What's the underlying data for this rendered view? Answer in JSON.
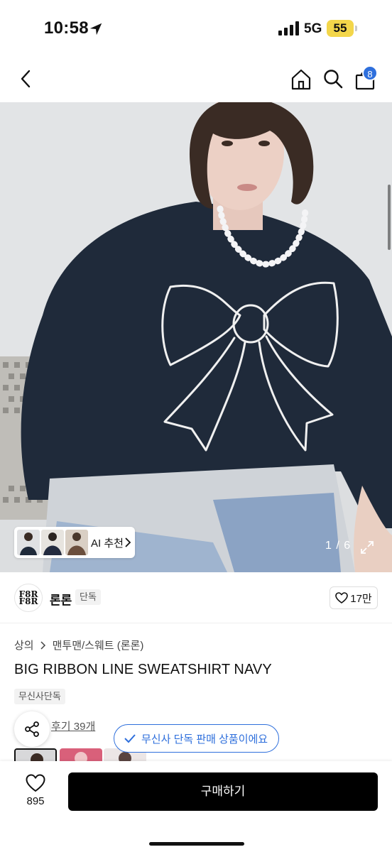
{
  "status_bar": {
    "time": "10:58",
    "network": "5G",
    "battery": "55"
  },
  "nav": {
    "cart_count": "8"
  },
  "gallery": {
    "ai_label": "AI 추천",
    "pager": "1 / 6"
  },
  "brand": {
    "logo_text_1": "F8R",
    "logo_text_2": "F8R",
    "name": "론론",
    "tag": "단독",
    "likes": "17만"
  },
  "product": {
    "breadcrumb": [
      "상의",
      "맨투맨/스웨트 (론론)"
    ],
    "title": "BIG RIBBON LINE SWEATSHIRT NAVY",
    "exclusive_tag": "무신사단독",
    "review_link": "후기 39개",
    "toast": "무신사 단독 판매 상품이에요"
  },
  "bottom": {
    "like_count": "895",
    "buy_label": "구매하기"
  },
  "colors": {
    "accent": "#2e6fdc",
    "battery": "#f3d64a",
    "sweatshirt": "#1f2a3a"
  }
}
